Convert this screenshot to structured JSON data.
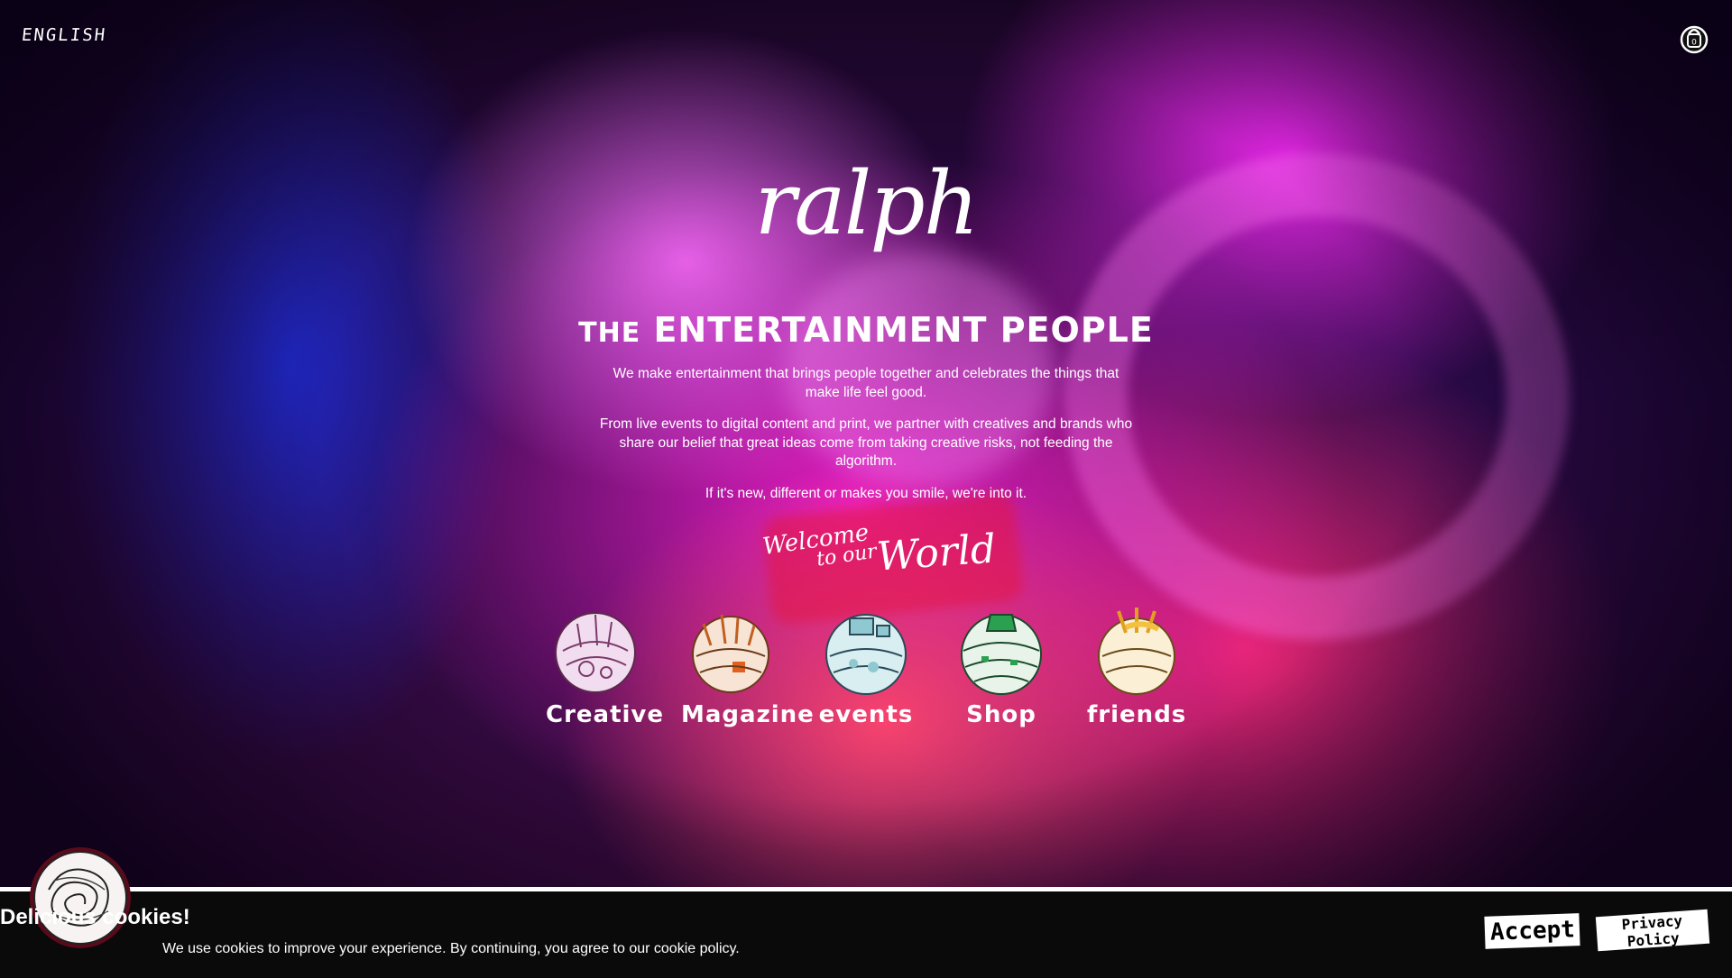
{
  "header": {
    "language_label": "ENGLISH",
    "basket_icon": "basket-icon",
    "basket_count": "0"
  },
  "hero": {
    "logo_text": "ralph",
    "tagline_prefix": "THE",
    "tagline_main": "ENTERTAINMENT PEOPLE",
    "paragraphs": [
      "We make entertainment that brings people together and celebrates the things that make life feel good.",
      "From live events to digital content and print, we partner with creatives and brands who share our belief that great ideas come from taking creative risks, not feeding the algorithm.",
      "If it's new, different or makes you smile, we're into it."
    ],
    "welcome_1": "Welcome",
    "welcome_2": "to our",
    "welcome_3": "World"
  },
  "worlds": [
    {
      "label": "Creative",
      "icon": "creative-world-icon",
      "color": "#e8c8e6"
    },
    {
      "label": "Magazine",
      "icon": "magazine-world-icon",
      "color": "#f0b070"
    },
    {
      "label": "events",
      "icon": "events-world-icon",
      "color": "#9ed2d8"
    },
    {
      "label": "Shop",
      "icon": "shop-world-icon",
      "color": "#3aa860"
    },
    {
      "label": "friends",
      "icon": "friends-world-icon",
      "color": "#f4c040"
    }
  ],
  "cookie": {
    "title": "Delicious cookies!",
    "text": "We use cookies to improve your experience. By continuing, you agree to our cookie policy.",
    "accept_label": "Accept",
    "privacy_label": "Privacy Policy",
    "badge_icon": "cookie-badge-icon"
  },
  "colors": {
    "magenta": "#f028f0",
    "blue": "#1e28c8",
    "pink_red": "#fa2878",
    "banner_bg": "#0a0a0a"
  }
}
